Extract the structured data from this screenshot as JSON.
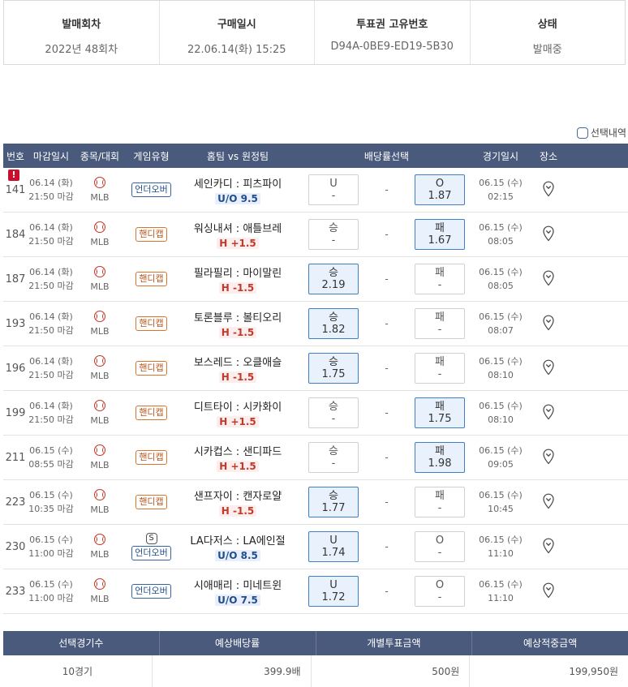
{
  "info": {
    "round_label": "발매회차",
    "round_value": "2022년 48회차",
    "purchase_label": "구매일시",
    "purchase_value": "22.06.14(화) 15:25",
    "ticket_label": "투표권 고유번호",
    "ticket_value": "D94A-0BE9-ED19-5B30",
    "status_label": "상태",
    "status_value": "발매중"
  },
  "legend": {
    "label": "선택내역"
  },
  "columns": {
    "no": "번호",
    "deadline": "마감일시",
    "sport": "종목/대회",
    "game_type": "게임유형",
    "teams": "홈팀 vs 원정팀",
    "bet": "배당률선택",
    "game_date": "경기일시",
    "place": "장소"
  },
  "rows": [
    {
      "no": "141",
      "alert": "!",
      "date": "06.14 (화)",
      "close": "21:50 마감",
      "sport": "MLB",
      "badge": "",
      "type": "언더오버",
      "type_kind": "uo",
      "teams": "세인카디 : 피츠파이",
      "line": "U/O 9.5",
      "line_kind": "blue",
      "o1_label": "U",
      "o1_value": "-",
      "o1_sel": false,
      "draw": "-",
      "o2_label": "O",
      "o2_value": "1.87",
      "o2_sel": true,
      "game_date": "06.15 (수)",
      "game_time": "02:15"
    },
    {
      "no": "184",
      "alert": "",
      "date": "06.14 (화)",
      "close": "21:50 마감",
      "sport": "MLB",
      "badge": "",
      "type": "핸디캡",
      "type_kind": "handi",
      "teams": "워싱내셔 : 애틀브레",
      "line": "H +1.5",
      "line_kind": "red",
      "o1_label": "승",
      "o1_value": "-",
      "o1_sel": false,
      "draw": "-",
      "o2_label": "패",
      "o2_value": "1.67",
      "o2_sel": true,
      "game_date": "06.15 (수)",
      "game_time": "08:05"
    },
    {
      "no": "187",
      "alert": "",
      "date": "06.14 (화)",
      "close": "21:50 마감",
      "sport": "MLB",
      "badge": "",
      "type": "핸디캡",
      "type_kind": "handi",
      "teams": "필라필리 : 마이말린",
      "line": "H -1.5",
      "line_kind": "red",
      "o1_label": "승",
      "o1_value": "2.19",
      "o1_sel": true,
      "draw": "-",
      "o2_label": "패",
      "o2_value": "-",
      "o2_sel": false,
      "game_date": "06.15 (수)",
      "game_time": "08:05"
    },
    {
      "no": "193",
      "alert": "",
      "date": "06.14 (화)",
      "close": "21:50 마감",
      "sport": "MLB",
      "badge": "",
      "type": "핸디캡",
      "type_kind": "handi",
      "teams": "토론블루 : 볼티오리",
      "line": "H -1.5",
      "line_kind": "red",
      "o1_label": "승",
      "o1_value": "1.82",
      "o1_sel": true,
      "draw": "-",
      "o2_label": "패",
      "o2_value": "-",
      "o2_sel": false,
      "game_date": "06.15 (수)",
      "game_time": "08:07"
    },
    {
      "no": "196",
      "alert": "",
      "date": "06.14 (화)",
      "close": "21:50 마감",
      "sport": "MLB",
      "badge": "",
      "type": "핸디캡",
      "type_kind": "handi",
      "teams": "보스레드 : 오클애슬",
      "line": "H -1.5",
      "line_kind": "red",
      "o1_label": "승",
      "o1_value": "1.75",
      "o1_sel": true,
      "draw": "-",
      "o2_label": "패",
      "o2_value": "-",
      "o2_sel": false,
      "game_date": "06.15 (수)",
      "game_time": "08:10"
    },
    {
      "no": "199",
      "alert": "",
      "date": "06.14 (화)",
      "close": "21:50 마감",
      "sport": "MLB",
      "badge": "",
      "type": "핸디캡",
      "type_kind": "handi",
      "teams": "디트타이 : 시카화이",
      "line": "H +1.5",
      "line_kind": "red",
      "o1_label": "승",
      "o1_value": "-",
      "o1_sel": false,
      "draw": "-",
      "o2_label": "패",
      "o2_value": "1.75",
      "o2_sel": true,
      "game_date": "06.15 (수)",
      "game_time": "08:10"
    },
    {
      "no": "211",
      "alert": "",
      "date": "06.15 (수)",
      "close": "08:55 마감",
      "sport": "MLB",
      "badge": "",
      "type": "핸디캡",
      "type_kind": "handi",
      "teams": "시카컵스 : 샌디파드",
      "line": "H +1.5",
      "line_kind": "red",
      "o1_label": "승",
      "o1_value": "-",
      "o1_sel": false,
      "draw": "-",
      "o2_label": "패",
      "o2_value": "1.98",
      "o2_sel": true,
      "game_date": "06.15 (수)",
      "game_time": "09:05"
    },
    {
      "no": "223",
      "alert": "",
      "date": "06.15 (수)",
      "close": "10:35 마감",
      "sport": "MLB",
      "badge": "",
      "type": "핸디캡",
      "type_kind": "handi",
      "teams": "샌프자이 : 캔자로얄",
      "line": "H -1.5",
      "line_kind": "red",
      "o1_label": "승",
      "o1_value": "1.77",
      "o1_sel": true,
      "draw": "-",
      "o2_label": "패",
      "o2_value": "-",
      "o2_sel": false,
      "game_date": "06.15 (수)",
      "game_time": "10:45"
    },
    {
      "no": "230",
      "alert": "",
      "date": "06.15 (수)",
      "close": "11:00 마감",
      "sport": "MLB",
      "badge": "S",
      "type": "언더오버",
      "type_kind": "uo",
      "teams": "LA다저스 : LA에인절",
      "line": "U/O 8.5",
      "line_kind": "blue",
      "o1_label": "U",
      "o1_value": "1.74",
      "o1_sel": true,
      "draw": "-",
      "o2_label": "O",
      "o2_value": "-",
      "o2_sel": false,
      "game_date": "06.15 (수)",
      "game_time": "11:10"
    },
    {
      "no": "233",
      "alert": "",
      "date": "06.15 (수)",
      "close": "11:00 마감",
      "sport": "MLB",
      "badge": "",
      "type": "언더오버",
      "type_kind": "uo",
      "teams": "시애매리 : 미네트윈",
      "line": "U/O 7.5",
      "line_kind": "blue",
      "o1_label": "U",
      "o1_value": "1.72",
      "o1_sel": true,
      "draw": "-",
      "o2_label": "O",
      "o2_value": "-",
      "o2_sel": false,
      "game_date": "06.15 (수)",
      "game_time": "11:10"
    }
  ],
  "summary": {
    "games_label": "선택경기수",
    "games_value": "10경기",
    "odds_label": "예상배당률",
    "odds_value": "399.9배",
    "stake_label": "개별투표금액",
    "stake_value": "500원",
    "payout_label": "예상적중금액",
    "payout_value": "199,950원"
  },
  "colors": {
    "header_bg": "#4a5a7d",
    "selected_bg": "#e9f2fc",
    "selected_border": "#3f7fc4",
    "handicap": "#d9742b",
    "underover": "#3465a4",
    "alert": "#c8102e"
  },
  "icons": {
    "sport": "baseball-icon",
    "place": "location-pin-icon",
    "alert": "alert-icon"
  }
}
